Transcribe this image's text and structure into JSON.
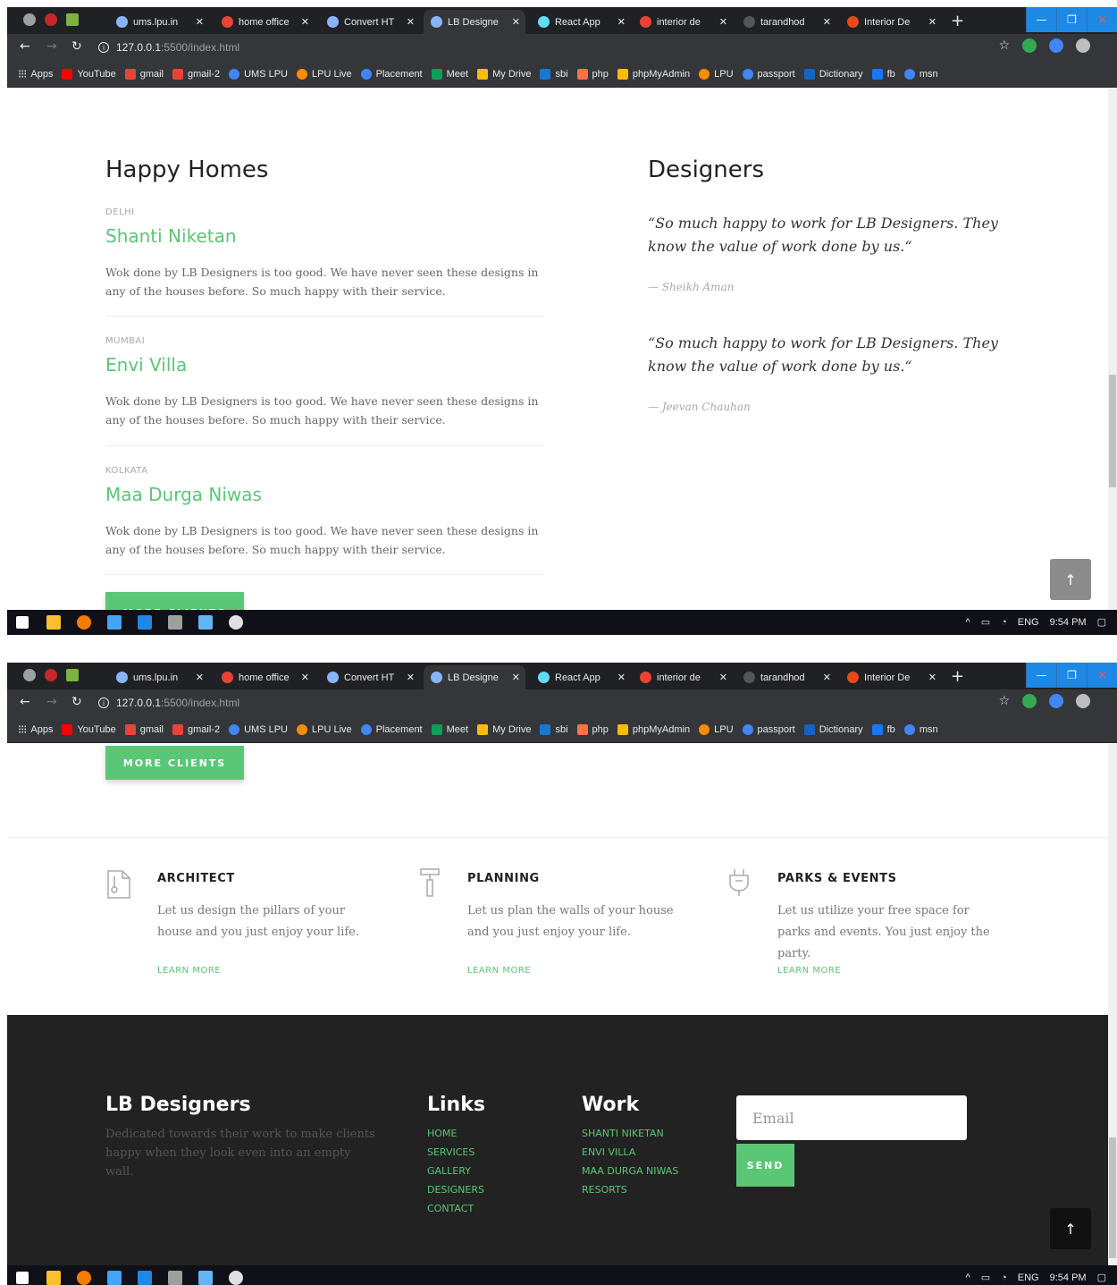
{
  "browser": {
    "tabs": [
      {
        "title": "ums.lpu.in"
      },
      {
        "title": "home office"
      },
      {
        "title": "Convert HT"
      },
      {
        "title": "LB Designe"
      },
      {
        "title": "React App"
      },
      {
        "title": "interior de"
      },
      {
        "title": "tarandhod"
      },
      {
        "title": "Interior De"
      }
    ],
    "url_host": "127.0.0.1",
    "url_path": ":5500/index.html",
    "bookmarks": [
      "Apps",
      "YouTube",
      "gmail",
      "gmail-2",
      "UMS LPU",
      "LPU Live",
      "Placement",
      "Meet",
      "My Drive",
      "sbi",
      "php",
      "phpMyAdmin",
      "LPU",
      "passport",
      "Dictionary",
      "fb",
      "msn"
    ]
  },
  "taskbar": {
    "lang": "ENG",
    "time": "9:54 PM"
  },
  "clients": {
    "title": "Happy Homes",
    "items": [
      {
        "city": "DELHI",
        "name": "Shanti Niketan",
        "desc": "Wok done by LB Designers is too good. We have never seen these designs in any of the houses before. So much happy with their service."
      },
      {
        "city": "MUMBAI",
        "name": "Envi Villa",
        "desc": "Wok done by LB Designers is too good. We have never seen these designs in any of the houses before. So much happy with their service."
      },
      {
        "city": "KOLKATA",
        "name": "Maa Durga Niwas",
        "desc": "Wok done by LB Designers is too good. We have never seen these designs in any of the houses before. So much happy with their service."
      }
    ],
    "more_button": "MORE CLIENTS"
  },
  "designers": {
    "title": "Designers",
    "testimonials": [
      {
        "quote": "“So much happy to work for LB Designers. They know the value of work done by us.“",
        "author": "— Sheikh Aman"
      },
      {
        "quote": "“So much happy to work for LB Designers. They know the value of work done by us.“",
        "author": "— Jeevan Chauhan"
      }
    ]
  },
  "features": [
    {
      "icon": "drawing-board-icon",
      "title": "ARCHITECT",
      "desc": "Let us design the pillars of your house and you just enjoy your life.",
      "link": "LEARN MORE"
    },
    {
      "icon": "paint-roller-icon",
      "title": "PLANNING",
      "desc": "Let us plan the walls of your house and you just enjoy your life.",
      "link": "LEARN MORE"
    },
    {
      "icon": "plug-icon",
      "title": "PARKS & EVENTS",
      "desc": "Let us utilize your free space for parks and events. You just enjoy the party.",
      "link": "LEARN MORE"
    }
  ],
  "footer": {
    "brand": "LB Designers",
    "tagline": "Dedicated towards their work to make clients happy when they look even into an empty wall.",
    "links_title": "Links",
    "links": [
      "HOME",
      "SERVICES",
      "GALLERY",
      "DESIGNERS",
      "CONTACT"
    ],
    "work_title": "Work",
    "work": [
      "SHANTI NIKETAN",
      "ENVI VILLA",
      "MAA DURGA NIWAS",
      "RESORTS"
    ],
    "email_placeholder": "Email",
    "send_button": "SEND"
  },
  "to_top_label": "↑",
  "colors": {
    "accent": "#5ac776",
    "footer_bg": "#222222",
    "to_top_light": "#8c8c8c",
    "to_top_dark": "#111111"
  }
}
